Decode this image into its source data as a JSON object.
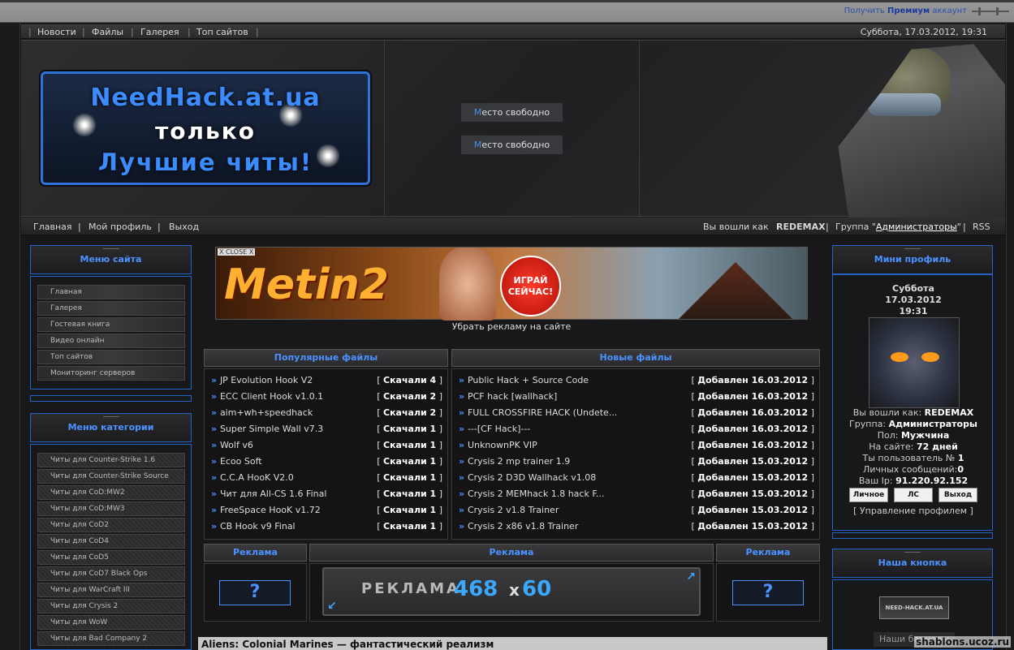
{
  "topbar": {
    "premium_prefix": "Получить",
    "premium_bold": "Премиум",
    "premium_suffix": "аккаунт"
  },
  "nav": {
    "items": [
      "Новости",
      "Файлы",
      "Галерея",
      "Топ сайтов"
    ],
    "datetime": "Суббота, 17.03.2012, 19:31"
  },
  "logo": {
    "line1": "NeedHack.at.ua",
    "line2": "только",
    "line3": "Лучшие читы!"
  },
  "header": {
    "free_slot_first": "М",
    "free_slot_rest": "есто свободно"
  },
  "subnav": {
    "items": [
      "Главная",
      "Мой профиль",
      "Выход"
    ],
    "logged_as": "Вы вошли как",
    "user": "REDEMAX",
    "group_prefix": "Группа \"",
    "group": "Администраторы",
    "group_suffix": "\"",
    "rss": "RSS"
  },
  "site_menu": {
    "title": "Меню сайта",
    "items": [
      "Главная",
      "Галерея",
      "Гостевая книга",
      "Видео онлайн",
      "Топ сайтов",
      "Мониторинг серверов"
    ]
  },
  "category_menu": {
    "title": "Меню категории",
    "items": [
      "Читы для Counter-Strike 1.6",
      "Читы для Counter-Strike Source",
      "Читы для CoD:MW2",
      "Читы для CoD:MW3",
      "Читы для CoD2",
      "Читы для CoD4",
      "Читы для CoD5",
      "Читы для CoD7 Black Ops",
      "Читы для WarCraft III",
      "Читы для Crysis 2",
      "Читы для WoW",
      "Читы для Bad Company 2"
    ]
  },
  "banner": {
    "close": "X CLOSE X",
    "title": "Metin2",
    "badge": "ИГРАЙ СЕЙЧАС!",
    "remove_ads": "Убрать рекламу на сайте"
  },
  "popular_files": {
    "title": "Популярные файлы",
    "rows": [
      {
        "name": "JP Evolution Hook V2",
        "stat": "Скачали 4"
      },
      {
        "name": "ECC Client Hook v1.0.1",
        "stat": "Скачали 2"
      },
      {
        "name": "aim+wh+speedhack",
        "stat": "Скачали 2"
      },
      {
        "name": "Super Simple Wall v7.3",
        "stat": "Скачали 1"
      },
      {
        "name": "Wolf v6",
        "stat": "Скачали 1"
      },
      {
        "name": "Ecoo Soft",
        "stat": "Скачали 1"
      },
      {
        "name": "C.C.A HooK V2.0",
        "stat": "Скачали 1"
      },
      {
        "name": "Чит для All-CS 1.6 Final",
        "stat": "Скачали 1"
      },
      {
        "name": "FreeSpace HooK v1.72",
        "stat": "Скачали 1"
      },
      {
        "name": "CB Hook v9 Final",
        "stat": "Скачали 1"
      }
    ]
  },
  "new_files": {
    "title": "Новые файлы",
    "rows": [
      {
        "name": "Public Hack + Source Code",
        "stat": "Добавлен 16.03.2012"
      },
      {
        "name": "PCF hack [wallhack]",
        "stat": "Добавлен 16.03.2012"
      },
      {
        "name": "FULL CROSSFIRE HACK (Undete...",
        "stat": "Добавлен 16.03.2012"
      },
      {
        "name": "---[CF Hack]---",
        "stat": "Добавлен 16.03.2012"
      },
      {
        "name": "UnknownPK VIP",
        "stat": "Добавлен 16.03.2012"
      },
      {
        "name": "Crysis 2 mp trainer 1.9",
        "stat": "Добавлен 15.03.2012"
      },
      {
        "name": "Crysis 2 D3D Wallhack v1.08",
        "stat": "Добавлен 15.03.2012"
      },
      {
        "name": "Crysis 2 MEMhack 1.8 hack F...",
        "stat": "Добавлен 15.03.2012"
      },
      {
        "name": "Crysis 2 v1.8 Trainer",
        "stat": "Добавлен 15.03.2012"
      },
      {
        "name": "Crysis 2 x86 v1.8 Trainer",
        "stat": "Добавлен 15.03.2012"
      }
    ]
  },
  "ads": {
    "label": "Реклама",
    "small": "?",
    "big_text": "РЕКЛАМА",
    "big_w": "468",
    "big_x": "x",
    "big_h": "60"
  },
  "mini_profile": {
    "title": "Мини профиль",
    "day": "Суббота",
    "date": "17.03.2012",
    "time": "19:31",
    "logged_label": "Вы вошли как:",
    "logged_value": "REDEMAX",
    "group_label": "Группа:",
    "group_value": "Администраторы",
    "gender_label": "Пол:",
    "gender_value": "Мужчина",
    "onsite_label": "На сайте:",
    "onsite_value": "72 дней",
    "usernum_label": "Ты пользователь №",
    "usernum_value": "1",
    "pm_label": "Личных сообщений:",
    "pm_value": "0",
    "ip_label": "Ваш Ip:",
    "ip_value": "91.220.92.152",
    "btn_personal": "Личное",
    "btn_pm": "ЛС",
    "btn_exit": "Выход",
    "manage": "[ Управление профилем ]"
  },
  "our_button": {
    "title": "Наша кнопка",
    "img_text": "NEED-HACK.AT.UA",
    "partners": "Наши баннеры"
  },
  "bottom": {
    "headline": "Aliens: Colonial Marines — фантастический реализм"
  },
  "watermark": "shablons.ucoz.ru"
}
